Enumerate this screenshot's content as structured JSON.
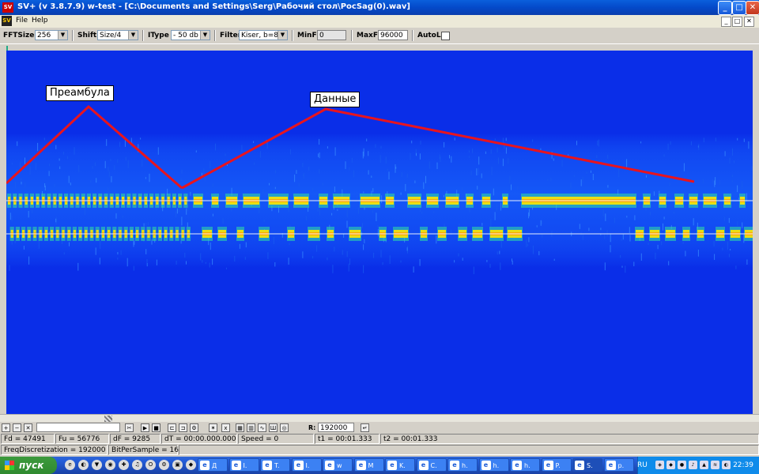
{
  "window": {
    "app_icon": "SV",
    "title": "SV+  (v 3.8.7.9) w-test  - [C:\\Documents and Settings\\Serg\\Рабочий стол\\PocSag(0).wav]",
    "minimize": "_",
    "maximize": "□",
    "close": "✕"
  },
  "menu": {
    "icon": "SV",
    "items": [
      "File",
      "Help"
    ],
    "mdi_buttons": [
      "_",
      "□",
      "✕"
    ]
  },
  "toolbar": {
    "fftsize_label": "FFTSize",
    "fftsize_value": "256",
    "shift_label": "Shift",
    "shift_value": "Size/4",
    "itype_label": "IType",
    "itype_value": "- 50 db",
    "filter_label": "Filter",
    "filter_value": "Kiser, b=8",
    "minf_label": "MinF",
    "minf_value": "0",
    "maxf_label": "MaxF",
    "maxf_value": "96000",
    "autol_label": "AutoL"
  },
  "annotations": {
    "preamble": "Преамбула",
    "data": "Данные"
  },
  "colors": {
    "background": "#0a2ee8",
    "noise": "#1a6cff",
    "signal_core": "#ffe600",
    "signal_glow": "#30e0a0",
    "annotation_line": "#e8141e",
    "marker_line": "#ffffff"
  },
  "bottom_toolbar": {
    "r_label": "R:",
    "r_value": "192000"
  },
  "status": {
    "fd": "Fd = 47491",
    "fu": "Fu = 56776",
    "df": "dF = 9285",
    "dt": "dT = 00:00.000.000",
    "speed": "Speed = 0",
    "t1": "t1 = 00:01.333",
    "t2": "t2 = 00:01.333",
    "freq": "FreqDiscretization = 192000",
    "bps": "BitPerSample = 16"
  },
  "taskbar": {
    "start": "пуск",
    "tasks": [
      "Д",
      "I.",
      "T.",
      "I.",
      "w",
      "M",
      "K.",
      "C.",
      "h.",
      "h.",
      "h.",
      "P.",
      "S.",
      "p."
    ],
    "lang": "RU",
    "clock": "22:39"
  }
}
